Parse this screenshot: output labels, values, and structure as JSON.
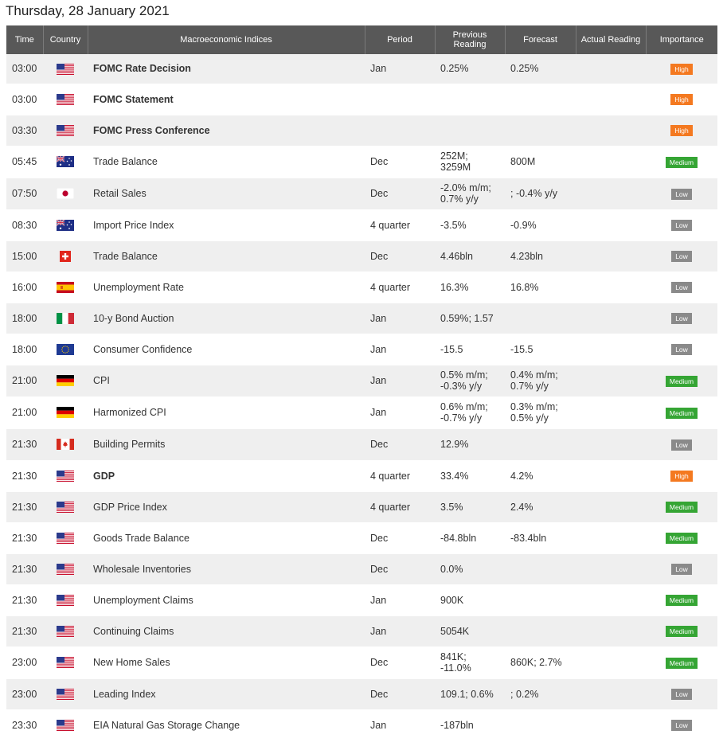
{
  "page_title": "Thursday, 28 January 2021",
  "headers": {
    "time": "Time",
    "country": "Country",
    "index": "Macroeconomic Indices",
    "period": "Period",
    "previous": "Previous Reading",
    "forecast": "Forecast",
    "actual": "Actual Reading",
    "importance": "Importance"
  },
  "importance_colors": {
    "High": "#f47920",
    "Medium": "#35a534",
    "Low": "#8a8a8a"
  },
  "rows": [
    {
      "time": "03:00",
      "flag": "us-flag",
      "index": "FOMC Rate Decision",
      "bold": true,
      "period": "Jan",
      "previous": "0.25%",
      "forecast": "0.25%",
      "actual": "",
      "importance": "High"
    },
    {
      "time": "03:00",
      "flag": "us-flag",
      "index": "FOMC Statement",
      "bold": true,
      "period": "",
      "previous": "",
      "forecast": "",
      "actual": "",
      "importance": "High"
    },
    {
      "time": "03:30",
      "flag": "us-flag",
      "index": "FOMC Press Conference",
      "bold": true,
      "period": "",
      "previous": "",
      "forecast": "",
      "actual": "",
      "importance": "High"
    },
    {
      "time": "05:45",
      "flag": "au-flag",
      "index": "Trade Balance",
      "bold": false,
      "period": "Dec",
      "previous": "252M; 3259M",
      "forecast": "800M",
      "actual": "",
      "importance": "Medium"
    },
    {
      "time": "07:50",
      "flag": "jp-flag",
      "index": "Retail Sales",
      "bold": false,
      "period": "Dec",
      "previous": "-2.0% m/m; 0.7% y/y",
      "forecast": "; -0.4% y/y",
      "actual": "",
      "importance": "Low"
    },
    {
      "time": "08:30",
      "flag": "au-flag",
      "index": "Import Price Index",
      "bold": false,
      "period": "4 quarter",
      "previous": "-3.5%",
      "forecast": "-0.9%",
      "actual": "",
      "importance": "Low"
    },
    {
      "time": "15:00",
      "flag": "ch-flag",
      "index": "Trade Balance",
      "bold": false,
      "period": "Dec",
      "previous": "4.46bln",
      "forecast": "4.23bln",
      "actual": "",
      "importance": "Low"
    },
    {
      "time": "16:00",
      "flag": "es-flag",
      "index": "Unemployment Rate",
      "bold": false,
      "period": "4 quarter",
      "previous": "16.3%",
      "forecast": "16.8%",
      "actual": "",
      "importance": "Low"
    },
    {
      "time": "18:00",
      "flag": "it-flag",
      "index": "10-y Bond Auction",
      "bold": false,
      "period": "Jan",
      "previous": "0.59%; 1.57",
      "forecast": "",
      "actual": "",
      "importance": "Low"
    },
    {
      "time": "18:00",
      "flag": "eu-flag",
      "index": "Consumer Confidence",
      "bold": false,
      "period": "Jan",
      "previous": "-15.5",
      "forecast": "-15.5",
      "actual": "",
      "importance": "Low"
    },
    {
      "time": "21:00",
      "flag": "de-flag",
      "index": "CPI",
      "bold": false,
      "period": "Jan",
      "previous": "0.5% m/m; -0.3% y/y",
      "forecast": "0.4% m/m; 0.7% y/y",
      "actual": "",
      "importance": "Medium"
    },
    {
      "time": "21:00",
      "flag": "de-flag",
      "index": "Harmonized CPI",
      "bold": false,
      "period": "Jan",
      "previous": "0.6% m/m; -0.7% y/y",
      "forecast": "0.3% m/m; 0.5% y/y",
      "actual": "",
      "importance": "Medium"
    },
    {
      "time": "21:30",
      "flag": "ca-flag",
      "index": "Building Permits",
      "bold": false,
      "period": "Dec",
      "previous": "12.9%",
      "forecast": "",
      "actual": "",
      "importance": "Low"
    },
    {
      "time": "21:30",
      "flag": "us-flag",
      "index": "GDP",
      "bold": true,
      "period": "4 quarter",
      "previous": "33.4%",
      "forecast": "4.2%",
      "actual": "",
      "importance": "High"
    },
    {
      "time": "21:30",
      "flag": "us-flag",
      "index": "GDP Price Index",
      "bold": false,
      "period": "4 quarter",
      "previous": "3.5%",
      "forecast": "2.4%",
      "actual": "",
      "importance": "Medium"
    },
    {
      "time": "21:30",
      "flag": "us-flag",
      "index": "Goods Trade Balance",
      "bold": false,
      "period": "Dec",
      "previous": "-84.8bln",
      "forecast": "-83.4bln",
      "actual": "",
      "importance": "Medium"
    },
    {
      "time": "21:30",
      "flag": "us-flag",
      "index": "Wholesale Inventories",
      "bold": false,
      "period": "Dec",
      "previous": "0.0%",
      "forecast": "",
      "actual": "",
      "importance": "Low"
    },
    {
      "time": "21:30",
      "flag": "us-flag",
      "index": "Unemployment Claims",
      "bold": false,
      "period": "Jan",
      "previous": "900K",
      "forecast": "",
      "actual": "",
      "importance": "Medium"
    },
    {
      "time": "21:30",
      "flag": "us-flag",
      "index": "Continuing Claims",
      "bold": false,
      "period": "Jan",
      "previous": "5054K",
      "forecast": "",
      "actual": "",
      "importance": "Medium"
    },
    {
      "time": "23:00",
      "flag": "us-flag",
      "index": "New Home Sales",
      "bold": false,
      "period": "Dec",
      "previous": "841K; -11.0%",
      "forecast": "860K; 2.7%",
      "actual": "",
      "importance": "Medium"
    },
    {
      "time": "23:00",
      "flag": "us-flag",
      "index": "Leading Index",
      "bold": false,
      "period": "Dec",
      "previous": "109.1; 0.6%",
      "forecast": "; 0.2%",
      "actual": "",
      "importance": "Low"
    },
    {
      "time": "23:30",
      "flag": "us-flag",
      "index": "EIA Natural Gas Storage Change",
      "bold": false,
      "period": "Jan",
      "previous": "-187bln",
      "forecast": "",
      "actual": "",
      "importance": "Low"
    }
  ]
}
